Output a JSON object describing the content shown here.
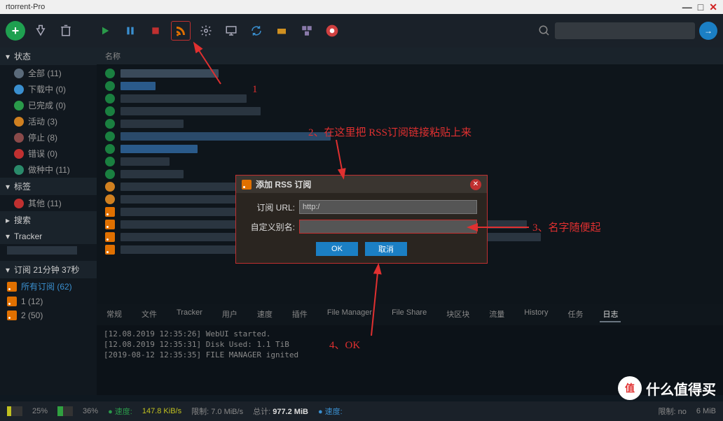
{
  "window": {
    "title": "rtorrent-Pro"
  },
  "sidebar": {
    "status_hdr": "状态",
    "items": [
      {
        "label": "全部 (11)",
        "color": "#5a6a7a"
      },
      {
        "label": "下载中 (0)",
        "color": "#3a8fcf"
      },
      {
        "label": "已完成 (0)",
        "color": "#2a9a4a"
      },
      {
        "label": "活动 (3)",
        "color": "#d08020"
      },
      {
        "label": "停止 (8)",
        "color": "#8a4a4a"
      },
      {
        "label": "错误 (0)",
        "color": "#c03030"
      },
      {
        "label": "做种中 (11)",
        "color": "#2a8a6a"
      }
    ],
    "tags_hdr": "标签",
    "other": "其他 (11)",
    "search_hdr": "搜索",
    "tracker_hdr": "Tracker",
    "feeds_hdr": "订阅 21分钟 37秒",
    "feeds": [
      {
        "label": "所有订阅 (62)",
        "active": true
      },
      {
        "label": "1 (12)"
      },
      {
        "label": "2 (50)"
      }
    ]
  },
  "toolbar": {
    "search_placeholder": ""
  },
  "table": {
    "name_col": "名称"
  },
  "tabs": [
    "常规",
    "文件",
    "Tracker",
    "用户",
    "速度",
    "插件",
    "File Manager",
    "File Share",
    "块区块",
    "流量",
    "History",
    "任务",
    "日志"
  ],
  "log": [
    "[12.08.2019 12:35:26] WebUI started.",
    "[12.08.2019 12:35:31] Disk Used: 1.1 TiB",
    "[2019-08-12 12:35:35] FILE MANAGER ignited"
  ],
  "status": {
    "p1": "25%",
    "p2": "36%",
    "dl_label": "速度:",
    "dl_speed": "147.8 KiB/s",
    "limit_label": "限制:",
    "limit_val": "7.0 MiB/s",
    "total_label": "总计:",
    "total_val": "977.2 MiB",
    "ul_label": "速度:",
    "limit2_label": "限制:",
    "limit2_val": "no",
    "extra": "6 MiB"
  },
  "dialog": {
    "title": "添加 RSS 订阅",
    "url_label": "订阅 URL:",
    "url_value": "http:/",
    "alias_label": "自定义别名:",
    "alias_value": "",
    "ok": "OK",
    "cancel": "取消"
  },
  "annotations": {
    "a1": "1",
    "a2": "2、在这里把         RSS订阅链接粘贴上来",
    "a3": "3、名字随便起",
    "a4": "4、OK"
  },
  "watermark": {
    "badge": "值",
    "text": "什么值得买"
  }
}
